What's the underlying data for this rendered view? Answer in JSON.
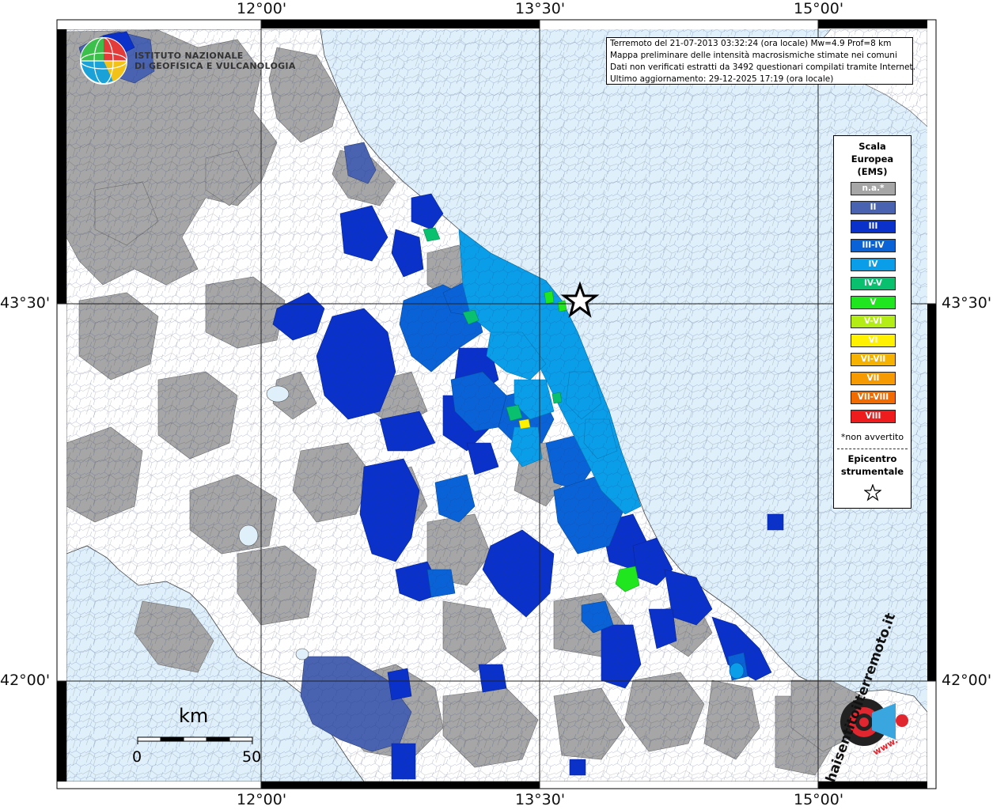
{
  "map": {
    "lon_ticks": [
      "12°00'",
      "13°30'",
      "15°00'"
    ],
    "lat_ticks": [
      "43°30'",
      "42°00'"
    ],
    "colors": {
      "sea": "#dff0fb",
      "land_na": "#a6a6a6",
      "land_unfelt": "#ffffff",
      "grid": "#222222"
    }
  },
  "info": {
    "line1": "Terremoto del 21-07-2013 03:32:24 (ora locale) Mw=4.9 Prof=8 km",
    "line2": "Mappa preliminare delle intensità macrosismiche stimate nei comuni",
    "line3": "Dati non verificati estratti da 3492 questionari compilati tramite Internet.",
    "line4": "Ultimo aggiornamento: 29-12-2025 17:19 (ora locale)"
  },
  "legend": {
    "title_line1": "Scala",
    "title_line2": "Europea",
    "title_line3": "(EMS)",
    "items": [
      {
        "label": "n.a.*",
        "color": "#a6a6a6"
      },
      {
        "label": "II",
        "color": "#4a63b0"
      },
      {
        "label": "III",
        "color": "#0a31c9"
      },
      {
        "label": "III-IV",
        "color": "#0a63d6"
      },
      {
        "label": "IV",
        "color": "#0b9ee8"
      },
      {
        "label": "IV-V",
        "color": "#08c06e"
      },
      {
        "label": "V",
        "color": "#1fe61f"
      },
      {
        "label": "V-VI",
        "color": "#b4ec16"
      },
      {
        "label": "VI",
        "color": "#fff100"
      },
      {
        "label": "VI-VII",
        "color": "#f5b300"
      },
      {
        "label": "VII",
        "color": "#f59a00"
      },
      {
        "label": "VII-VIII",
        "color": "#f26b00"
      },
      {
        "label": "VIII",
        "color": "#ee1c1c"
      }
    ],
    "note": "*non avvertito",
    "epicenter_line1": "Epicentro",
    "epicenter_line2": "strumentale",
    "epicenter_icon": "star-outline-icon"
  },
  "logo_ingv": {
    "line1": "ISTITUTO NAZIONALE",
    "line2": "DI GEOFISICA E VULCANOLOGIA",
    "icon": "ingv-globe-icon"
  },
  "logo_hst": {
    "text": "haisentitoilterremoto.it",
    "www": "www.",
    "icon": "loudspeaker-icon"
  },
  "scale_bar": {
    "unit": "km",
    "start": "0",
    "end": "50"
  },
  "epicenter_marker": "epicenter-star-icon"
}
